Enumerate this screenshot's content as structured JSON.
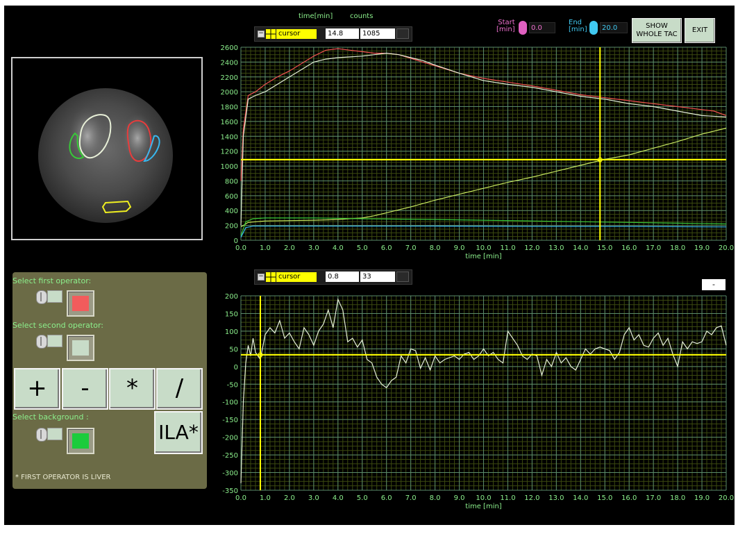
{
  "top_chart": {
    "header_time_label": "time[min]",
    "header_counts_label": "counts",
    "cursor": {
      "name": "cursor",
      "time": "14.8",
      "counts": "1085"
    },
    "start": {
      "label_line1": "Start",
      "label_line2": "[min]",
      "value": "0.0"
    },
    "end": {
      "label_line1": "End",
      "label_line2": "[min]",
      "value": "20.0"
    },
    "xlabel": "time [min]"
  },
  "buttons": {
    "show_whole_tac_line1": "SHOW",
    "show_whole_tac_line2": "WHOLE TAC",
    "exit": "EXIT"
  },
  "bottom_chart": {
    "cursor": {
      "name": "cursor",
      "time": "0.8",
      "counts": "33"
    },
    "indicator": "-",
    "xlabel": "time [min]"
  },
  "operator_panel": {
    "first_operator_label": "Select first operator:",
    "second_operator_label": "Select second operator:",
    "background_label": "Select background :",
    "ops": [
      "+",
      "-",
      "*",
      "/"
    ],
    "ila_button": "ILA*",
    "note": "* FIRST OPERATOR IS LIVER",
    "first_color": "#f25c5c",
    "second_color": "#c8dcc8",
    "background_color": "#1ccc3c"
  },
  "colors": {
    "grid_minor": "#3c4a10",
    "grid_major": "#5a8a6a",
    "tick_text": "#8cf08c",
    "cursor_line": "#ffff00",
    "roi_liver": "#e8f0d8",
    "roi_left_kidney": "#e83c3c",
    "roi_right_kidney_green": "#38c838",
    "roi_blue": "#38b8f0",
    "roi_bladder": "#f0f020"
  },
  "chart_data": [
    {
      "type": "line",
      "xlabel": "time [min]",
      "xlim": [
        0,
        20
      ],
      "ylim": [
        0,
        2600
      ],
      "x_ticks": [
        "0.0",
        "1.0",
        "2.0",
        "3.0",
        "4.0",
        "5.0",
        "6.0",
        "7.0",
        "8.0",
        "9.0",
        "10.0",
        "11.0",
        "12.0",
        "13.0",
        "14.0",
        "15.0",
        "16.0",
        "17.0",
        "18.0",
        "19.0",
        "20.0"
      ],
      "y_ticks": [
        "0",
        "200",
        "400",
        "600",
        "800",
        "1000",
        "1200",
        "1400",
        "1600",
        "1800",
        "2000",
        "2200",
        "2400",
        "2600"
      ],
      "cursor": {
        "x": 14.8,
        "y": 1085
      },
      "series": [
        {
          "color": "#f05050",
          "points": [
            [
              0,
              800
            ],
            [
              0.1,
              1500
            ],
            [
              0.3,
              1950
            ],
            [
              0.6,
              2000
            ],
            [
              1,
              2100
            ],
            [
              1.5,
              2200
            ],
            [
              2,
              2280
            ],
            [
              2.5,
              2380
            ],
            [
              3,
              2480
            ],
            [
              3.5,
              2560
            ],
            [
              4,
              2580
            ],
            [
              4.5,
              2560
            ],
            [
              5,
              2540
            ],
            [
              5.5,
              2520
            ],
            [
              6,
              2520
            ],
            [
              6.5,
              2500
            ],
            [
              7,
              2450
            ],
            [
              7.5,
              2400
            ],
            [
              8,
              2350
            ],
            [
              9,
              2250
            ],
            [
              10,
              2180
            ],
            [
              11,
              2130
            ],
            [
              12,
              2080
            ],
            [
              13,
              2020
            ],
            [
              14,
              1960
            ],
            [
              15,
              1920
            ],
            [
              16,
              1880
            ],
            [
              17,
              1840
            ],
            [
              18,
              1800
            ],
            [
              19,
              1760
            ],
            [
              19.5,
              1740
            ],
            [
              20,
              1680
            ]
          ]
        },
        {
          "color": "#e6f0d8",
          "points": [
            [
              0,
              200
            ],
            [
              0.1,
              1400
            ],
            [
              0.3,
              1900
            ],
            [
              0.6,
              1950
            ],
            [
              1,
              2000
            ],
            [
              1.5,
              2100
            ],
            [
              2,
              2200
            ],
            [
              2.5,
              2300
            ],
            [
              3,
              2400
            ],
            [
              3.5,
              2440
            ],
            [
              4,
              2460
            ],
            [
              5,
              2480
            ],
            [
              5.5,
              2500
            ],
            [
              6,
              2520
            ],
            [
              6.5,
              2500
            ],
            [
              7,
              2460
            ],
            [
              7.5,
              2420
            ],
            [
              8,
              2360
            ],
            [
              9,
              2250
            ],
            [
              10,
              2150
            ],
            [
              11,
              2100
            ],
            [
              12,
              2060
            ],
            [
              13,
              2000
            ],
            [
              14,
              1940
            ],
            [
              15,
              1900
            ],
            [
              16,
              1840
            ],
            [
              17,
              1800
            ],
            [
              18,
              1740
            ],
            [
              19,
              1680
            ],
            [
              20,
              1660
            ]
          ]
        },
        {
          "color": "#c8e860",
          "points": [
            [
              0,
              180
            ],
            [
              0.3,
              240
            ],
            [
              1,
              260
            ],
            [
              2,
              265
            ],
            [
              3,
              270
            ],
            [
              4,
              280
            ],
            [
              5,
              300
            ],
            [
              5.5,
              330
            ],
            [
              6,
              370
            ],
            [
              7,
              450
            ],
            [
              8,
              540
            ],
            [
              9,
              620
            ],
            [
              10,
              700
            ],
            [
              11,
              780
            ],
            [
              12,
              850
            ],
            [
              13,
              930
            ],
            [
              14,
              1010
            ],
            [
              15,
              1090
            ],
            [
              16,
              1150
            ],
            [
              17,
              1240
            ],
            [
              18,
              1330
            ],
            [
              19,
              1430
            ],
            [
              20,
              1510
            ]
          ]
        },
        {
          "color": "#38c838",
          "points": [
            [
              0,
              60
            ],
            [
              0.2,
              250
            ],
            [
              0.5,
              290
            ],
            [
              1,
              300
            ],
            [
              3,
              300
            ],
            [
              5,
              290
            ],
            [
              8,
              280
            ],
            [
              10,
              270
            ],
            [
              12,
              260
            ],
            [
              14,
              250
            ],
            [
              16,
              240
            ],
            [
              18,
              230
            ],
            [
              20,
              220
            ]
          ]
        },
        {
          "color": "#38b8f0",
          "points": [
            [
              0,
              40
            ],
            [
              0.2,
              170
            ],
            [
              0.5,
              190
            ],
            [
              1,
              190
            ],
            [
              4,
              190
            ],
            [
              8,
              190
            ],
            [
              12,
              185
            ],
            [
              16,
              185
            ],
            [
              20,
              180
            ]
          ]
        }
      ]
    },
    {
      "type": "line",
      "xlabel": "time [min]",
      "xlim": [
        0,
        20
      ],
      "ylim": [
        -350,
        200
      ],
      "x_ticks": [
        "0.0",
        "1.0",
        "2.0",
        "3.0",
        "4.0",
        "5.0",
        "6.0",
        "7.0",
        "8.0",
        "9.0",
        "10.0",
        "11.0",
        "12.0",
        "13.0",
        "14.0",
        "15.0",
        "16.0",
        "17.0",
        "18.0",
        "19.0",
        "20.0"
      ],
      "y_ticks": [
        "200",
        "150",
        "100",
        "50",
        "0",
        "-50",
        "-100",
        "-150",
        "-200",
        "-250",
        "-300",
        "-350"
      ],
      "cursor": {
        "x": 0.8,
        "y": 33
      },
      "series": [
        {
          "color": "#e6f0d8",
          "points": [
            [
              0,
              -330
            ],
            [
              0.1,
              -100
            ],
            [
              0.2,
              10
            ],
            [
              0.3,
              60
            ],
            [
              0.4,
              30
            ],
            [
              0.5,
              80
            ],
            [
              0.6,
              40
            ],
            [
              0.8,
              20
            ],
            [
              1.0,
              90
            ],
            [
              1.2,
              110
            ],
            [
              1.4,
              95
            ],
            [
              1.6,
              130
            ],
            [
              1.8,
              80
            ],
            [
              2.0,
              95
            ],
            [
              2.2,
              70
            ],
            [
              2.4,
              50
            ],
            [
              2.6,
              110
            ],
            [
              2.8,
              90
            ],
            [
              3.0,
              60
            ],
            [
              3.2,
              100
            ],
            [
              3.4,
              120
            ],
            [
              3.6,
              160
            ],
            [
              3.8,
              110
            ],
            [
              4.0,
              190
            ],
            [
              4.2,
              160
            ],
            [
              4.4,
              70
            ],
            [
              4.6,
              80
            ],
            [
              4.8,
              55
            ],
            [
              5.0,
              75
            ],
            [
              5.2,
              20
            ],
            [
              5.4,
              10
            ],
            [
              5.6,
              -30
            ],
            [
              5.8,
              -50
            ],
            [
              6.0,
              -60
            ],
            [
              6.2,
              -40
            ],
            [
              6.4,
              -30
            ],
            [
              6.6,
              30
            ],
            [
              6.8,
              10
            ],
            [
              7.0,
              50
            ],
            [
              7.2,
              45
            ],
            [
              7.4,
              -5
            ],
            [
              7.6,
              25
            ],
            [
              7.8,
              -10
            ],
            [
              8.0,
              30
            ],
            [
              8.2,
              10
            ],
            [
              8.4,
              20
            ],
            [
              8.6,
              25
            ],
            [
              8.8,
              30
            ],
            [
              9.0,
              20
            ],
            [
              9.2,
              35
            ],
            [
              9.4,
              40
            ],
            [
              9.6,
              20
            ],
            [
              9.8,
              30
            ],
            [
              10.0,
              50
            ],
            [
              10.2,
              30
            ],
            [
              10.4,
              40
            ],
            [
              10.6,
              20
            ],
            [
              10.8,
              10
            ],
            [
              11.0,
              100
            ],
            [
              11.2,
              80
            ],
            [
              11.4,
              60
            ],
            [
              11.6,
              30
            ],
            [
              11.8,
              20
            ],
            [
              12.0,
              35
            ],
            [
              12.2,
              30
            ],
            [
              12.4,
              -25
            ],
            [
              12.6,
              20
            ],
            [
              12.8,
              0
            ],
            [
              13.0,
              40
            ],
            [
              13.2,
              10
            ],
            [
              13.4,
              25
            ],
            [
              13.6,
              0
            ],
            [
              13.8,
              -10
            ],
            [
              14.0,
              20
            ],
            [
              14.2,
              50
            ],
            [
              14.4,
              35
            ],
            [
              14.6,
              50
            ],
            [
              14.8,
              55
            ],
            [
              15.0,
              50
            ],
            [
              15.2,
              45
            ],
            [
              15.4,
              20
            ],
            [
              15.6,
              40
            ],
            [
              15.8,
              90
            ],
            [
              16.0,
              110
            ],
            [
              16.2,
              75
            ],
            [
              16.4,
              90
            ],
            [
              16.6,
              60
            ],
            [
              16.8,
              55
            ],
            [
              17.0,
              80
            ],
            [
              17.2,
              95
            ],
            [
              17.4,
              60
            ],
            [
              17.6,
              80
            ],
            [
              17.8,
              35
            ],
            [
              18.0,
              0
            ],
            [
              18.2,
              70
            ],
            [
              18.4,
              50
            ],
            [
              18.6,
              70
            ],
            [
              18.8,
              65
            ],
            [
              19.0,
              70
            ],
            [
              19.2,
              100
            ],
            [
              19.4,
              90
            ],
            [
              19.6,
              110
            ],
            [
              19.8,
              115
            ],
            [
              20.0,
              60
            ]
          ]
        }
      ]
    }
  ]
}
